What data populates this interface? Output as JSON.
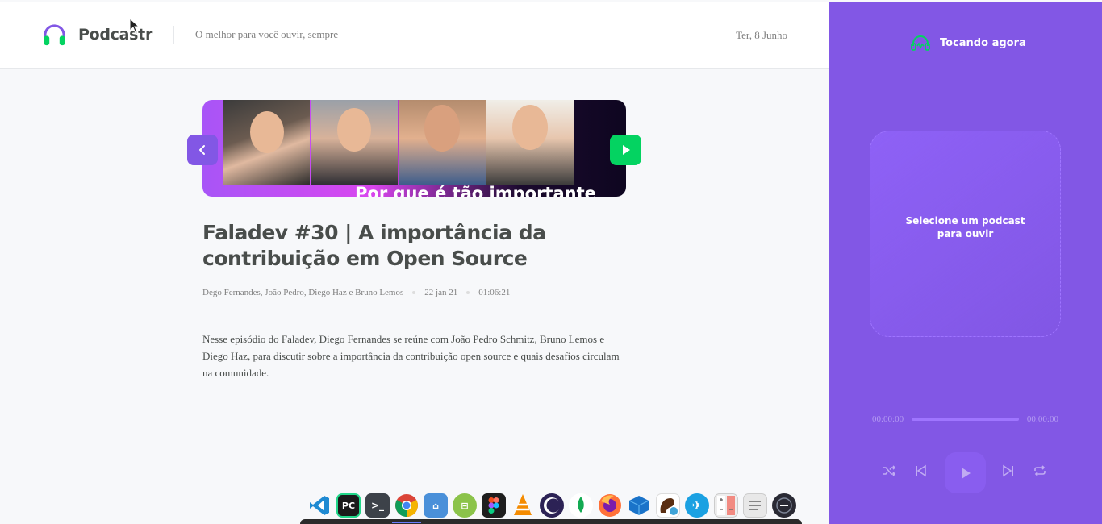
{
  "header": {
    "app_name": "Podcastr",
    "tagline": "O melhor para você ouvir, sempre",
    "date": "Ter, 8 Junho",
    "logo_icon": "headphones-icon"
  },
  "episode": {
    "thumbnail_caption": "Por que é tão importante",
    "title": "Faladev #30 | A importância da contribuição em Open Source",
    "members": "Dego Fernandes, João Pedro, Diego Haz e Bruno Lemos",
    "published_at": "22 jan 21",
    "duration": "01:06:21",
    "description": "Nesse episódio do Faladev, Diego Fernandes se reúne com João Pedro Schmitz, Bruno Lemos e Diego Haz, para discutir sobre a importância da contribuição open source e quais desafios circulam na comunidade.",
    "prev_icon": "chevron-left-icon",
    "play_icon": "play-icon"
  },
  "player": {
    "heading": "Tocando agora",
    "heading_icon": "headphones-icon",
    "empty_message": "Selecione um podcast para ouvir",
    "current_time": "00:00:00",
    "total_time": "00:00:00",
    "progress": 0,
    "controls": [
      "shuffle-icon",
      "previous-icon",
      "play-icon",
      "next-icon",
      "repeat-icon"
    ]
  },
  "colors": {
    "purple": "#8257e5",
    "green": "#04d361",
    "text": "#494d4b",
    "muted": "#808080"
  },
  "dock": {
    "apps": [
      "vscode",
      "pycharm",
      "terminal",
      "chrome",
      "files",
      "android-studio",
      "figma",
      "vlc",
      "eclipse",
      "mongodb-compass",
      "firefox",
      "virtualbox",
      "intellij-ce",
      "xcode-like",
      "calculator",
      "text-editor",
      "tor"
    ]
  }
}
